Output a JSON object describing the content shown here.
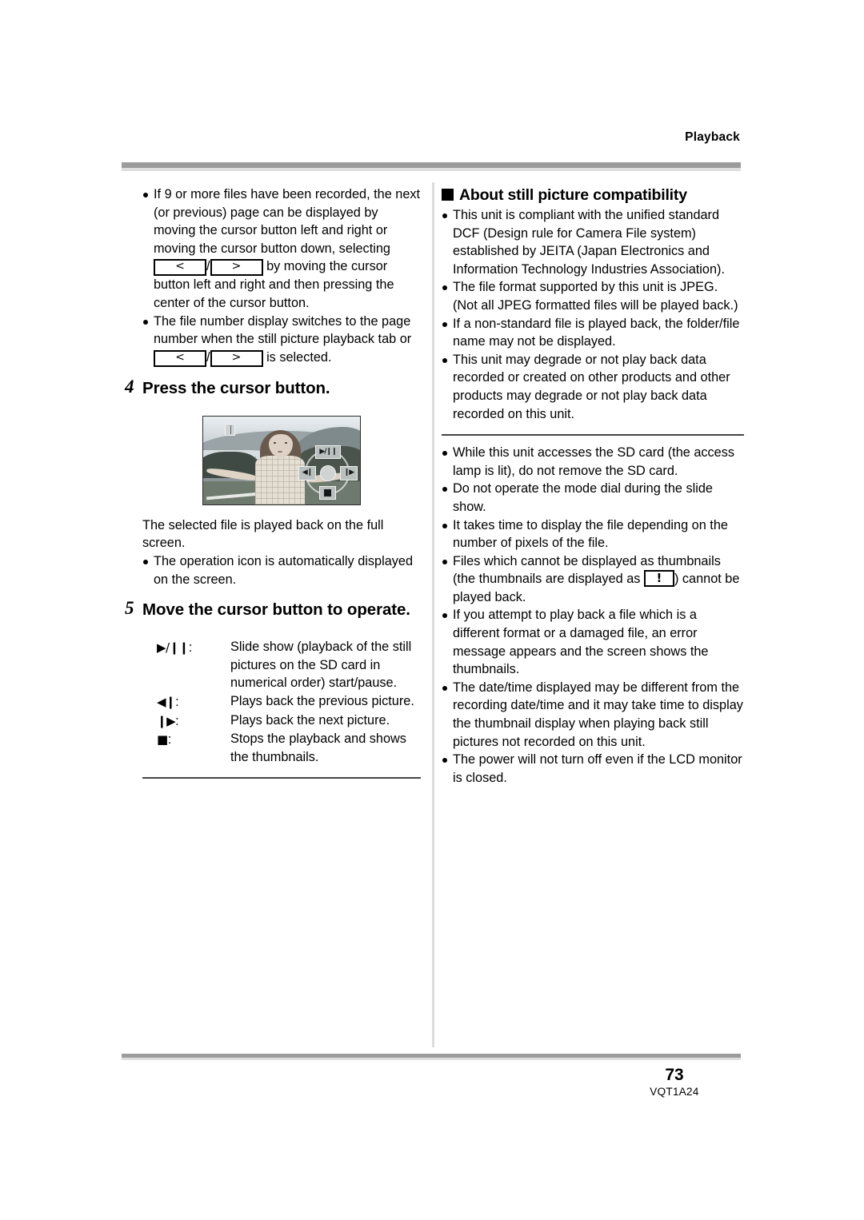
{
  "header": {
    "running_head": "Playback"
  },
  "footer": {
    "page_number": "73",
    "doc_code": "VQT1A24"
  },
  "left_column": {
    "bullets_top": [
      {
        "part1": "If 9 or more files have been recorded, the next (or previous) page can be displayed by moving the cursor button left and right or moving the cursor button down, selecting",
        "key_left": "<",
        "separator": "/",
        "key_right": ">",
        "part2": "by moving the cursor button left and right and then pressing the center of the cursor button."
      },
      {
        "part1": "The file number display switches to the page number when the still picture playback tab or",
        "key_left": "<",
        "separator": "/",
        "key_right": ">",
        "part2": "is selected."
      }
    ],
    "step4": {
      "number": "4",
      "title": "Press the cursor button."
    },
    "figure": {
      "pause_icon": "pause-icon",
      "ops": {
        "up": "▶/❙❙",
        "left": "◀❙",
        "right": "❙▶",
        "down": "stop-square"
      }
    },
    "after_figure": {
      "paragraph": "The selected file is played back on the full screen.",
      "bullet": "The operation icon is automatically displayed on the screen."
    },
    "step5": {
      "number": "5",
      "title": "Move the cursor button to operate."
    },
    "legend": [
      {
        "symbol": "▶/❙❙",
        "symbol_name": "play-pause-icon",
        "description": "Slide show (playback of the still pictures on the SD card in numerical order) start/pause."
      },
      {
        "symbol": "◀❙",
        "symbol_name": "previous-picture-icon",
        "description": "Plays back the previous picture."
      },
      {
        "symbol": "❙▶",
        "symbol_name": "next-picture-icon",
        "description": "Plays back the next picture."
      },
      {
        "symbol": "■",
        "symbol_name": "stop-icon",
        "description": "Stops the playback and shows the thumbnails."
      }
    ]
  },
  "right_column": {
    "section_heading": "About still picture compatibility",
    "bullets_group1": [
      "This unit is compliant with the unified standard DCF (Design rule for Camera File system) established by JEITA (Japan Electronics and Information Technology Industries Association).",
      "The file format supported by this unit is JPEG. (Not all JPEG formatted files will be played back.)",
      "If a non-standard file is played back, the folder/file name may not be displayed.",
      "This unit may degrade or not play back data recorded or created on other products and other products may degrade or not play back data recorded on this unit."
    ],
    "bullets_group2_pre": [
      "While this unit accesses the SD card (the access lamp is lit), do not remove the SD card.",
      "Do not operate the mode dial during the slide show.",
      "It takes time to display the file depending on the number of pixels of the file."
    ],
    "bullet_thumbnail_warning": {
      "part1": "Files which cannot be displayed as thumbnails (the thumbnails are displayed as",
      "key": "!",
      "part2": ") cannot be played back."
    },
    "bullets_group2_post": [
      "If you attempt to play back a file which is a different format or a damaged file, an error message appears and the screen shows the thumbnails.",
      "The date/time displayed may be different from the recording date/time and it may take time to display the thumbnail display when playing back still pictures not recorded on this unit.",
      "The power will not turn off even if the LCD monitor is closed."
    ]
  }
}
